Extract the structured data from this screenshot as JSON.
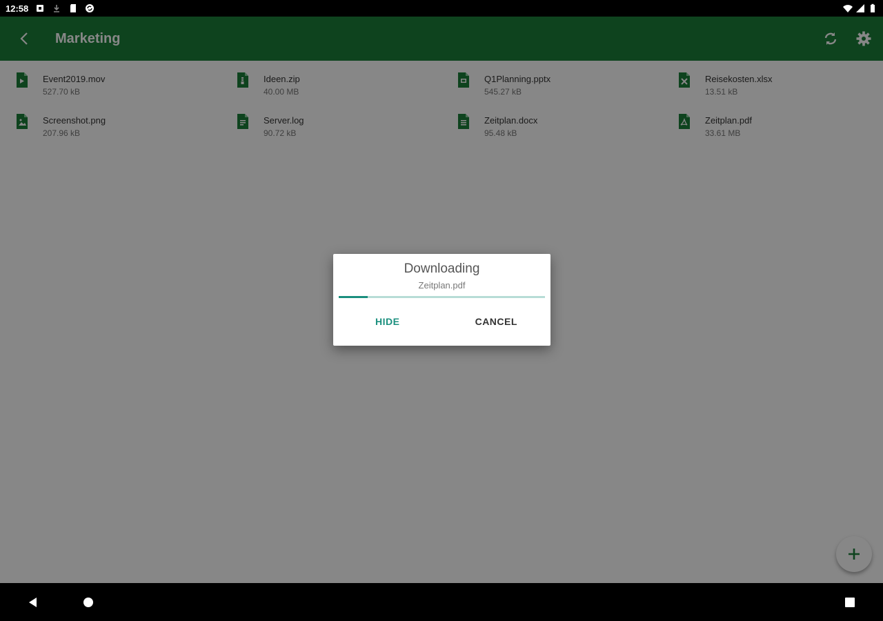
{
  "status_bar": {
    "time": "12:58"
  },
  "app_bar": {
    "title": "Marketing",
    "color": "#1b7f3a"
  },
  "files": [
    {
      "name": "Event2019.mov",
      "size": "527.70 kB",
      "icon": "video-file-icon"
    },
    {
      "name": "Ideen.zip",
      "size": "40.00 MB",
      "icon": "archive-file-icon"
    },
    {
      "name": "Q1Planning.pptx",
      "size": "545.27 kB",
      "icon": "presentation-file-icon"
    },
    {
      "name": "Reisekosten.xlsx",
      "size": "13.51 kB",
      "icon": "spreadsheet-file-icon"
    },
    {
      "name": "Screenshot.png",
      "size": "207.96 kB",
      "icon": "image-file-icon"
    },
    {
      "name": "Server.log",
      "size": "90.72 kB",
      "icon": "text-file-icon"
    },
    {
      "name": "Zeitplan.docx",
      "size": "95.48 kB",
      "icon": "document-file-icon"
    },
    {
      "name": "Zeitplan.pdf",
      "size": "33.61 MB",
      "icon": "pdf-file-icon"
    }
  ],
  "dialog": {
    "title": "Downloading",
    "filename": "Zeitplan.pdf",
    "progress": 0.14,
    "hide_label": "HIDE",
    "cancel_label": "CANCEL",
    "accent": "#1a8f7e"
  }
}
